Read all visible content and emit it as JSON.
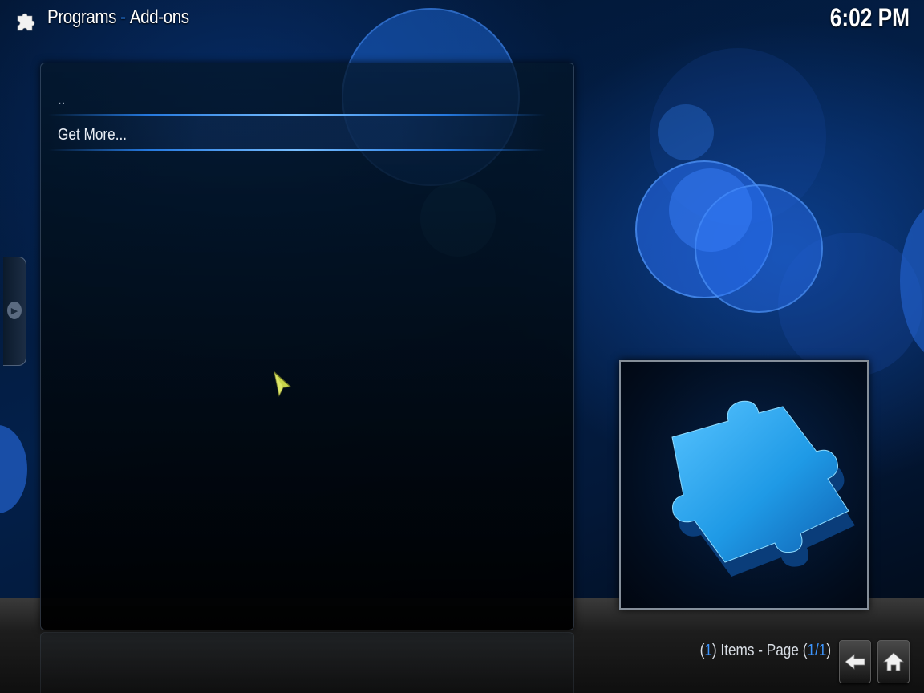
{
  "header": {
    "section": "Programs",
    "separator": "-",
    "subsection": "Add-ons",
    "icon": "puzzle-icon"
  },
  "clock": "6:02 PM",
  "list": {
    "items": [
      {
        "label": ".."
      },
      {
        "label": "Get More..."
      }
    ]
  },
  "thumbnail": {
    "icon": "puzzle-piece-thumbnail"
  },
  "footer": {
    "item_count": "1",
    "items_label": "Items - Page",
    "page": "1/1",
    "back_icon": "back-arrow-icon",
    "home_icon": "home-icon"
  },
  "colors": {
    "accent": "#3d96ff",
    "highlight_line": "#2882f0",
    "text": "#ffffff"
  }
}
